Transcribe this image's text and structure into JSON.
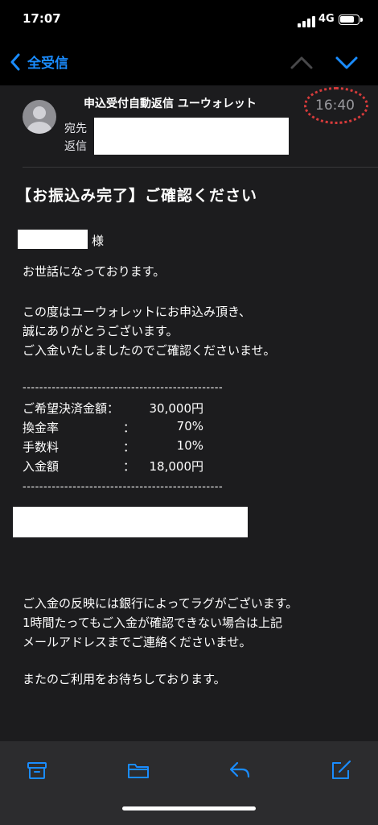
{
  "status_bar": {
    "time": "17:07",
    "network": "4G"
  },
  "nav": {
    "back_label": "全受信"
  },
  "header": {
    "sender": "申込受付自動返信 ユーウォレット",
    "to_label": "宛先",
    "reply_label": "返信",
    "time": "16:40"
  },
  "email": {
    "subject": "【お振込み完了】ご確認ください",
    "salutation_suffix": "様",
    "greeting": "お世話になっております。",
    "para1": [
      "この度はユーウォレットにお申込み頂き、",
      "誠にありがとうございます。",
      "ご入金いたしましたのでご確認くださいませ。"
    ],
    "separator": "------------------------------------------------",
    "table": [
      {
        "label": "ご希望決済金額：",
        "colon": "",
        "value": "30,000円"
      },
      {
        "label": "換金率",
        "colon": "：",
        "value": "70%"
      },
      {
        "label": "手数料",
        "colon": "：",
        "value": "10%"
      },
      {
        "label": "入金額",
        "colon": "：",
        "value": "18,000円"
      }
    ],
    "para2": [
      "ご入金の反映には銀行によってラグがございます。",
      "1時間たってもご入金が確認できない場合は上記",
      "メールアドレスまでご連絡くださいませ。"
    ],
    "closing": "またのご利用をお待ちしております。"
  },
  "toolbar": {
    "icons": [
      "archive-icon",
      "folder-icon",
      "reply-icon",
      "compose-icon"
    ]
  },
  "colors": {
    "accent": "#1a8cff",
    "background": "#1c1c1e",
    "annotation": "#d63b3b"
  }
}
